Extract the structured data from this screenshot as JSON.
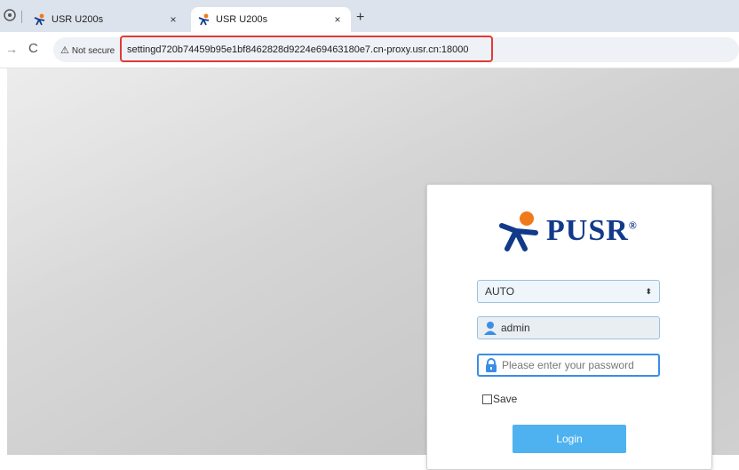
{
  "browser": {
    "tabs": [
      {
        "title": "USR U200s",
        "active": false
      },
      {
        "title": "USR U200s",
        "active": true
      }
    ],
    "tab_close_glyph": "×",
    "new_tab_glyph": "+",
    "security_label": "Not secure",
    "url": "settingd720b74459b95e1bf8462828d9224e69463180e7.cn-proxy.usr.cn:18000",
    "highlight_color": "#e53935"
  },
  "login": {
    "brand": "PUSR",
    "brand_mark": "®",
    "mode_select": {
      "selected": "AUTO"
    },
    "username": "admin",
    "password_placeholder": "Please enter your password",
    "save_label": "Save",
    "login_label": "Login",
    "button_color": "#4eb2f0",
    "brand_color": "#123a8a"
  }
}
